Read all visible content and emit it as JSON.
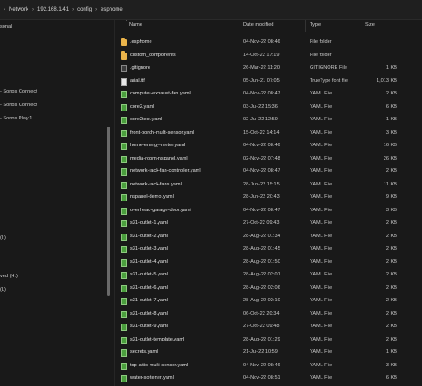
{
  "address_bar": {
    "crumbs": [
      "Network",
      "192.168.1.41",
      "config",
      "esphome"
    ]
  },
  "nav_pane": {
    "items": [
      "sonal",
      "- Sonos Connect",
      "- Sonos Connect",
      "- Sonos Play:1",
      "(I:)",
      "ved (H:)",
      "(L)"
    ]
  },
  "columns": {
    "name": "Name",
    "date": "Date modified",
    "type": "Type",
    "size": "Size"
  },
  "files": [
    {
      "name": ".esphome",
      "date": "04-Nov-22 08:46",
      "type": "File folder",
      "size": "",
      "icon": "folder"
    },
    {
      "name": "custom_components",
      "date": "14-Oct-22 17:19",
      "type": "File folder",
      "size": "",
      "icon": "folder"
    },
    {
      "name": ".gitignore",
      "date": "26-Mar-22 11:20",
      "type": "GITIGNORE File",
      "size": "1 KB",
      "icon": "file"
    },
    {
      "name": "arial.ttf",
      "date": "05-Jun-21 07:05",
      "type": "TrueType font file",
      "size": "1,013 KB",
      "icon": "ttf"
    },
    {
      "name": "computer-exhaust-fan.yaml",
      "date": "04-Nov-22 08:47",
      "type": "YAML File",
      "size": "2 KB",
      "icon": "yaml"
    },
    {
      "name": "core2.yaml",
      "date": "03-Jul-22 15:36",
      "type": "YAML File",
      "size": "6 KB",
      "icon": "yaml"
    },
    {
      "name": "core2test.yaml",
      "date": "02-Jul-22 12:59",
      "type": "YAML File",
      "size": "1 KB",
      "icon": "yaml"
    },
    {
      "name": "front-porch-multi-sensor.yaml",
      "date": "15-Oct-22 14:14",
      "type": "YAML File",
      "size": "3 KB",
      "icon": "yaml"
    },
    {
      "name": "home-energy-meter.yaml",
      "date": "04-Nov-22 08:46",
      "type": "YAML File",
      "size": "16 KB",
      "icon": "yaml"
    },
    {
      "name": "media-room-nspanel.yaml",
      "date": "02-Nov-22 07:48",
      "type": "YAML File",
      "size": "26 KB",
      "icon": "yaml"
    },
    {
      "name": "network-rack-fan-controller.yaml",
      "date": "04-Nov-22 08:47",
      "type": "YAML File",
      "size": "2 KB",
      "icon": "yaml"
    },
    {
      "name": "network-rack-fans.yaml",
      "date": "28-Jun-22 15:15",
      "type": "YAML File",
      "size": "11 KB",
      "icon": "yaml"
    },
    {
      "name": "nspanel-demo.yaml",
      "date": "28-Jun-22 20:43",
      "type": "YAML File",
      "size": "9 KB",
      "icon": "yaml"
    },
    {
      "name": "overhead-garage-door.yaml",
      "date": "04-Nov-22 08:47",
      "type": "YAML File",
      "size": "3 KB",
      "icon": "yaml"
    },
    {
      "name": "s31-outlet-1.yaml",
      "date": "27-Oct-22 09:43",
      "type": "YAML File",
      "size": "2 KB",
      "icon": "yaml"
    },
    {
      "name": "s31-outlet-2.yaml",
      "date": "28-Aug-22 01:34",
      "type": "YAML File",
      "size": "2 KB",
      "icon": "yaml"
    },
    {
      "name": "s31-outlet-3.yaml",
      "date": "28-Aug-22 01:45",
      "type": "YAML File",
      "size": "2 KB",
      "icon": "yaml"
    },
    {
      "name": "s31-outlet-4.yaml",
      "date": "28-Aug-22 01:50",
      "type": "YAML File",
      "size": "2 KB",
      "icon": "yaml"
    },
    {
      "name": "s31-outlet-5.yaml",
      "date": "28-Aug-22 02:01",
      "type": "YAML File",
      "size": "2 KB",
      "icon": "yaml"
    },
    {
      "name": "s31-outlet-6.yaml",
      "date": "28-Aug-22 02:06",
      "type": "YAML File",
      "size": "2 KB",
      "icon": "yaml"
    },
    {
      "name": "s31-outlet-7.yaml",
      "date": "28-Aug-22 02:10",
      "type": "YAML File",
      "size": "2 KB",
      "icon": "yaml"
    },
    {
      "name": "s31-outlet-8.yaml",
      "date": "06-Oct-22 20:34",
      "type": "YAML File",
      "size": "2 KB",
      "icon": "yaml"
    },
    {
      "name": "s31-outlet-9.yaml",
      "date": "27-Oct-22 09:48",
      "type": "YAML File",
      "size": "2 KB",
      "icon": "yaml"
    },
    {
      "name": "s31-outlet-template.yaml",
      "date": "28-Aug-22 01:29",
      "type": "YAML File",
      "size": "2 KB",
      "icon": "yaml"
    },
    {
      "name": "secrets.yaml",
      "date": "21-Jul-22 10:59",
      "type": "YAML File",
      "size": "1 KB",
      "icon": "yaml"
    },
    {
      "name": "top-attic-multi-sensor.yaml",
      "date": "04-Nov-22 08:46",
      "type": "YAML File",
      "size": "3 KB",
      "icon": "yaml"
    },
    {
      "name": "water-softener.yaml",
      "date": "04-Nov-22 08:51",
      "type": "YAML File",
      "size": "6 KB",
      "icon": "yaml"
    }
  ]
}
